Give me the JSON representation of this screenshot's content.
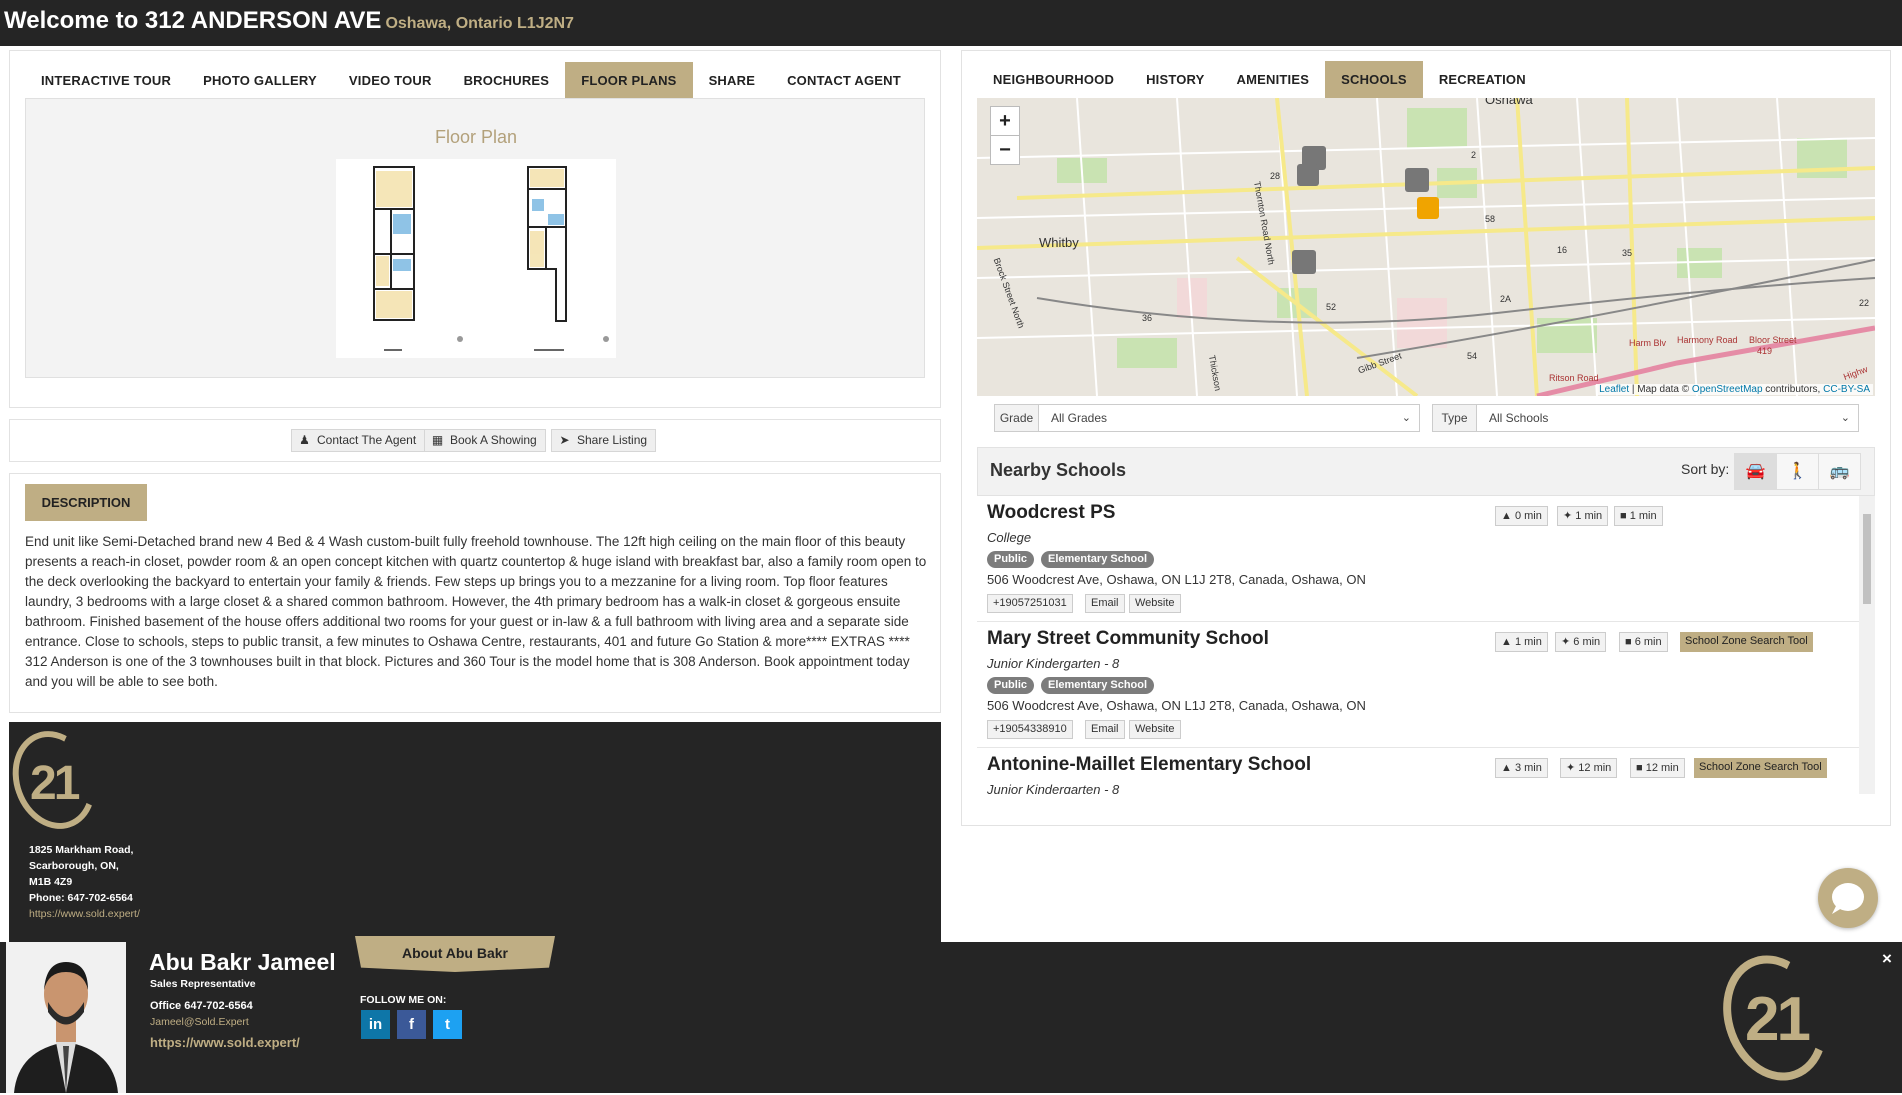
{
  "header": {
    "title": "Welcome to 312 ANDERSON AVE",
    "subtitle": "Oshawa, Ontario L1J2N7"
  },
  "left_tabs": [
    {
      "label": "INTERACTIVE TOUR"
    },
    {
      "label": "PHOTO GALLERY"
    },
    {
      "label": "VIDEO TOUR"
    },
    {
      "label": "BROCHURES"
    },
    {
      "label": "FLOOR PLANS",
      "active": true
    },
    {
      "label": "SHARE"
    },
    {
      "label": "CONTACT AGENT"
    }
  ],
  "floorplan": {
    "title": "Floor Plan"
  },
  "actions": [
    {
      "label": "Contact The Agent",
      "icon": "person-icon"
    },
    {
      "label": "Book A Showing",
      "icon": "calendar-icon"
    },
    {
      "label": "Share Listing",
      "icon": "share-icon"
    }
  ],
  "description": {
    "label": "DESCRIPTION",
    "text": "End unit like Semi-Detached brand new 4 Bed & 4 Wash custom-built fully freehold townhouse. The 12ft high ceiling on the main floor of this beauty presents a reach-in closet, powder room & an open concept kitchen with quartz countertop & huge island with breakfast bar, also a family room open to the deck overlooking the backyard to entertain your family & friends. Few steps up brings you to a mezzanine for a living room. Top floor features laundry, 3 bedrooms with a large closet & a shared common bathroom. However, the 4th primary bedroom has a walk-in closet & gorgeous ensuite bathroom. Finished basement of the house offers additional two rooms for your guest or in-law & a full bathroom with living area and a separate side entrance. Close to schools, steps to public transit, a few minutes to Oshawa Centre, restaurants, 401 and future Go Station & more**** EXTRAS **** 312 Anderson is one of the 3 townhouses built in that block. Pictures and 360 Tour is the model home that is 308 Anderson. Book appointment today and you will be able to see both."
  },
  "office": {
    "logo": "21",
    "address1": "1825 Markham Road,",
    "address2": "Scarborough, ON,",
    "postal": "M1B 4Z9",
    "phone": "Phone: 647-702-6564",
    "url": "https://www.sold.expert/"
  },
  "agent": {
    "name": "Abu Bakr Jameel",
    "role": "Sales Representative",
    "office_phone": "Office 647-702-6564",
    "email": "Jameel@Sold.Expert",
    "website": "https://www.sold.expert/",
    "about_label": "About Abu Bakr",
    "follow_label": "FOLLOW ME ON:",
    "social": [
      {
        "glyph": "in",
        "icon": "linkedin-icon",
        "color": "#0e76a8"
      },
      {
        "glyph": "f",
        "icon": "facebook-icon",
        "color": "#3b5998"
      },
      {
        "glyph": "t",
        "icon": "twitter-icon",
        "color": "#1da1f2"
      }
    ],
    "close_glyph": "×"
  },
  "right_tabs": [
    {
      "label": "NEIGHBOURHOOD"
    },
    {
      "label": "HISTORY"
    },
    {
      "label": "AMENITIES"
    },
    {
      "label": "SCHOOLS",
      "active": true
    },
    {
      "label": "RECREATION"
    }
  ],
  "map": {
    "zoom_in": "+",
    "zoom_out": "−",
    "labels": [
      "Oshawa",
      "Whitby",
      "Thornton Road North",
      "Brock Street North",
      "Gibb Street",
      "Harmony Road",
      "Bloor Street",
      "Ritson Road",
      "Thickson",
      "Harm Blv",
      "Highw"
    ],
    "route_numbers": [
      "28",
      "2",
      "58",
      "16",
      "35",
      "2A",
      "52",
      "36",
      "54",
      "22",
      "419"
    ],
    "attribution_leaflet": "Leaflet",
    "attribution_mid": " | Map data © ",
    "attribution_osm": "OpenStreetMap",
    "attribution_end": " contributors, ",
    "attribution_license": "CC-BY-SA"
  },
  "filters": {
    "grade_label": "Grade",
    "grade_value": "All Grades",
    "type_label": "Type",
    "type_value": "All Schools"
  },
  "nearby": {
    "title": "Nearby Schools",
    "sort_label": "Sort by:",
    "sort_options": [
      "car-icon",
      "walk-icon",
      "bus-icon"
    ]
  },
  "schools": [
    {
      "name": "Woodcrest PS",
      "grade": "College",
      "badges": [
        "Public",
        "Elementary School"
      ],
      "address": "506 Woodcrest Ave, Oshawa, ON L1J 2T8, Canada, Oshawa, ON",
      "phone": "+19057251031",
      "email": "Email",
      "website": "Website",
      "drive": "0 min",
      "walk": "1 min",
      "transit": "1 min"
    },
    {
      "name": "Mary Street Community School",
      "grade": "Junior Kindergarten - 8",
      "badges": [
        "Public",
        "Elementary School"
      ],
      "address": "506 Woodcrest Ave, Oshawa, ON L1J 2T8, Canada, Oshawa, ON",
      "phone": "+19054338910",
      "email": "Email",
      "website": "Website",
      "drive": "1 min",
      "walk": "6 min",
      "transit": "6 min",
      "zone_tool": "School Zone Search Tool"
    },
    {
      "name": "Antonine-Maillet Elementary School",
      "grade": "Junior Kindergarten - 8",
      "drive": "3 min",
      "walk": "12 min",
      "transit": "12 min",
      "zone_tool": "School Zone Search Tool"
    }
  ],
  "colors": {
    "accent": "#bfae84",
    "dark": "#252525",
    "badge": "#7c7c7c"
  }
}
